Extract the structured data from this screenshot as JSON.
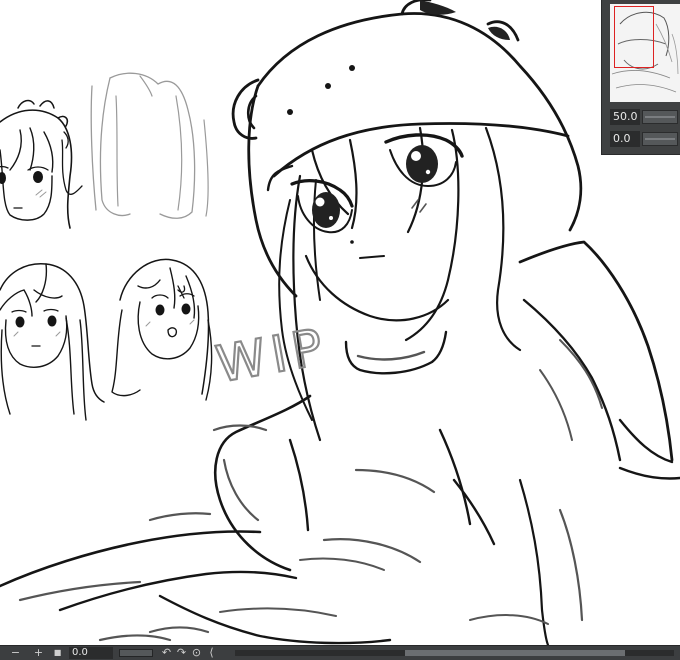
{
  "navigator": {
    "zoom_value": "50.0",
    "rotation_value": "0.0"
  },
  "status_bar": {
    "zoom_out_label": "−",
    "zoom_in_label": "+",
    "fit_label": "■",
    "rotation_value": "0.0",
    "rotate_left_label": "↶",
    "rotate_right_label": "↷",
    "reset_label": "⊙",
    "flip_label": "⟨"
  },
  "canvas": {
    "sketch_text": "WIP"
  },
  "icons": {
    "zoom_out": "minus-icon",
    "zoom_in": "plus-icon",
    "fit": "square-icon",
    "rotate_left": "rotate-left-icon",
    "rotate_right": "rotate-right-icon",
    "reset": "reset-view-icon",
    "flip": "chevron-left-icon"
  },
  "colors": {
    "panel_bg": "#3f4142",
    "field_bg": "#2b2c2d",
    "navigator_frame": "#dd2222",
    "line_art": "#151515"
  }
}
